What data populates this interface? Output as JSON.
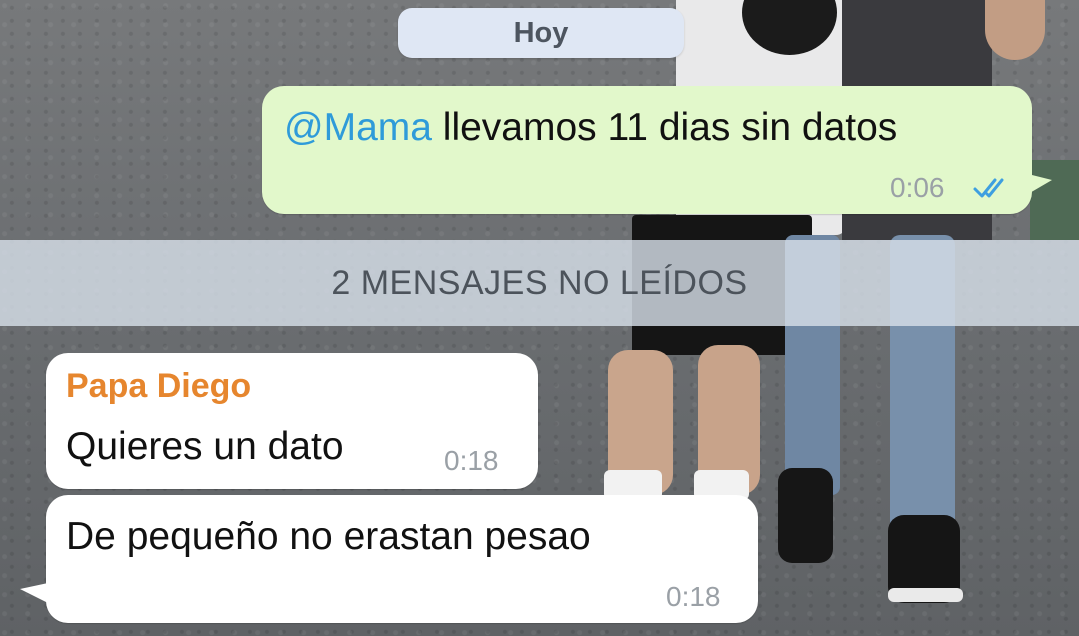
{
  "chat": {
    "date_pill": "Hoy",
    "unread_banner": "2 MENSAJES NO LEÍDOS",
    "messages": [
      {
        "direction": "outgoing",
        "mention": "@Mama",
        "text": " llevamos 11 dias sin datos",
        "time": "0:06",
        "status_icon": "double-check-read-icon"
      },
      {
        "direction": "incoming",
        "sender": "Papa Diego",
        "text": "Quieres un dato",
        "time": "0:18"
      },
      {
        "direction": "incoming",
        "text": "De pequeño no erastan pesao",
        "time": "0:18"
      }
    ]
  },
  "colors": {
    "outgoing_bubble": "#e2f8cb",
    "incoming_bubble": "#ffffff",
    "sender_name": "#e6862e",
    "mention": "#2f9bd9",
    "read_ticks": "#3e9fe0"
  }
}
